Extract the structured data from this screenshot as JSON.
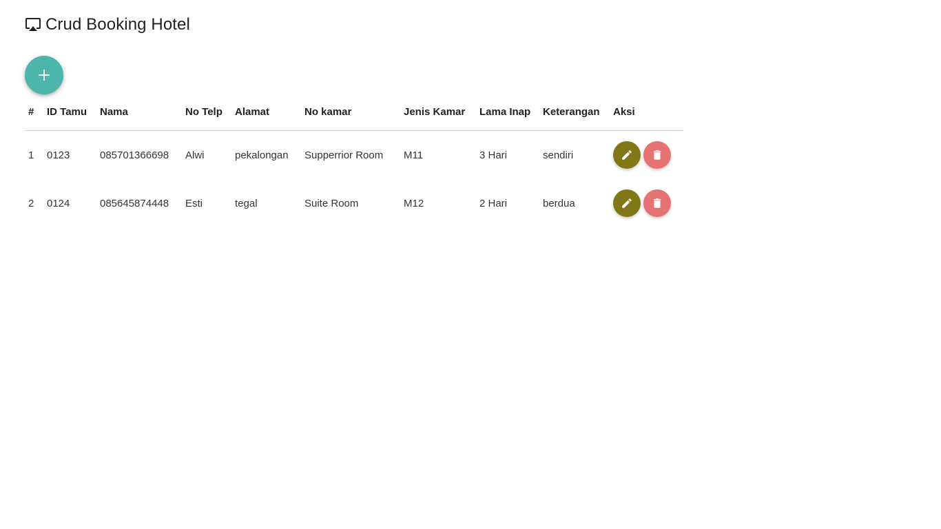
{
  "header": {
    "title": "Crud Booking Hotel",
    "icon": "airplay-icon"
  },
  "add_button": {
    "icon": "plus-icon",
    "color": "#4db6ac"
  },
  "table": {
    "columns": [
      "#",
      "ID Tamu",
      "Nama",
      "No Telp",
      "Alamat",
      "No kamar",
      "Jenis Kamar",
      "Lama Inap",
      "Keterangan",
      "Aksi"
    ],
    "rows": [
      [
        "1",
        "0123",
        "085701366698",
        "Alwi",
        "pekalongan",
        "Supperrior Room",
        "M11",
        "3 Hari",
        "sendiri"
      ],
      [
        "2",
        "0124",
        "085645874448",
        "Esti",
        "tegal",
        "Suite Room",
        "M12",
        "2 Hari",
        "berdua"
      ]
    ]
  },
  "actions": {
    "edit_icon": "pencil-icon",
    "edit_color": "#827717",
    "delete_icon": "trash-icon",
    "delete_color": "#e57373"
  }
}
